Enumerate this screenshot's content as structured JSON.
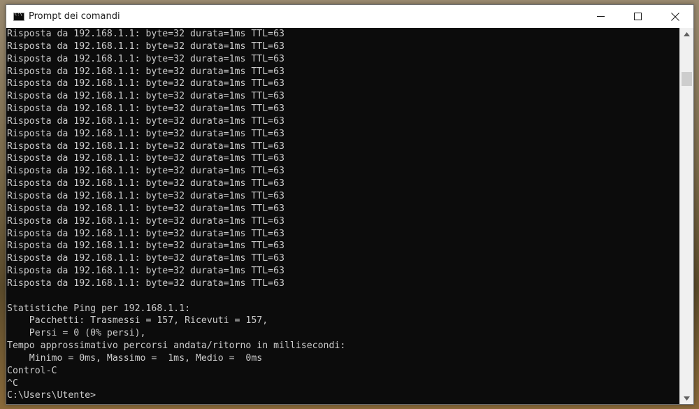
{
  "window": {
    "title": "Prompt dei comandi",
    "app_icon": "cmd-icon"
  },
  "controls": {
    "minimize_icon": "minimize-icon",
    "maximize_icon": "maximize-icon",
    "close_icon": "close-icon"
  },
  "console": {
    "lines": [
      "Risposta da 192.168.1.1: byte=32 durata=1ms TTL=63",
      "Risposta da 192.168.1.1: byte=32 durata=1ms TTL=63",
      "Risposta da 192.168.1.1: byte=32 durata=1ms TTL=63",
      "Risposta da 192.168.1.1: byte=32 durata=1ms TTL=63",
      "Risposta da 192.168.1.1: byte=32 durata=1ms TTL=63",
      "Risposta da 192.168.1.1: byte=32 durata=1ms TTL=63",
      "Risposta da 192.168.1.1: byte=32 durata=1ms TTL=63",
      "Risposta da 192.168.1.1: byte=32 durata=1ms TTL=63",
      "Risposta da 192.168.1.1: byte=32 durata=1ms TTL=63",
      "Risposta da 192.168.1.1: byte=32 durata=1ms TTL=63",
      "Risposta da 192.168.1.1: byte=32 durata=1ms TTL=63",
      "Risposta da 192.168.1.1: byte=32 durata=1ms TTL=63",
      "Risposta da 192.168.1.1: byte=32 durata=1ms TTL=63",
      "Risposta da 192.168.1.1: byte=32 durata=1ms TTL=63",
      "Risposta da 192.168.1.1: byte=32 durata=1ms TTL=63",
      "Risposta da 192.168.1.1: byte=32 durata=1ms TTL=63",
      "Risposta da 192.168.1.1: byte=32 durata=1ms TTL=63",
      "Risposta da 192.168.1.1: byte=32 durata=1ms TTL=63",
      "Risposta da 192.168.1.1: byte=32 durata=1ms TTL=63",
      "Risposta da 192.168.1.1: byte=32 durata=1ms TTL=63",
      "Risposta da 192.168.1.1: byte=32 durata=1ms TTL=63",
      "",
      "Statistiche Ping per 192.168.1.1:",
      "    Pacchetti: Trasmessi = 157, Ricevuti = 157,",
      "    Persi = 0 (0% persi),",
      "Tempo approssimativo percorsi andata/ritorno in millisecondi:",
      "    Minimo = 0ms, Massimo =  1ms, Medio =  0ms",
      "Control-C",
      "^C",
      "C:\\Users\\Utente>"
    ]
  },
  "scrollbar": {
    "up_icon": "scroll-up-icon",
    "down_icon": "scroll-down-icon"
  },
  "colors": {
    "console_bg": "#0c0c0c",
    "console_fg": "#cccccc",
    "titlebar_bg": "#ffffff"
  }
}
